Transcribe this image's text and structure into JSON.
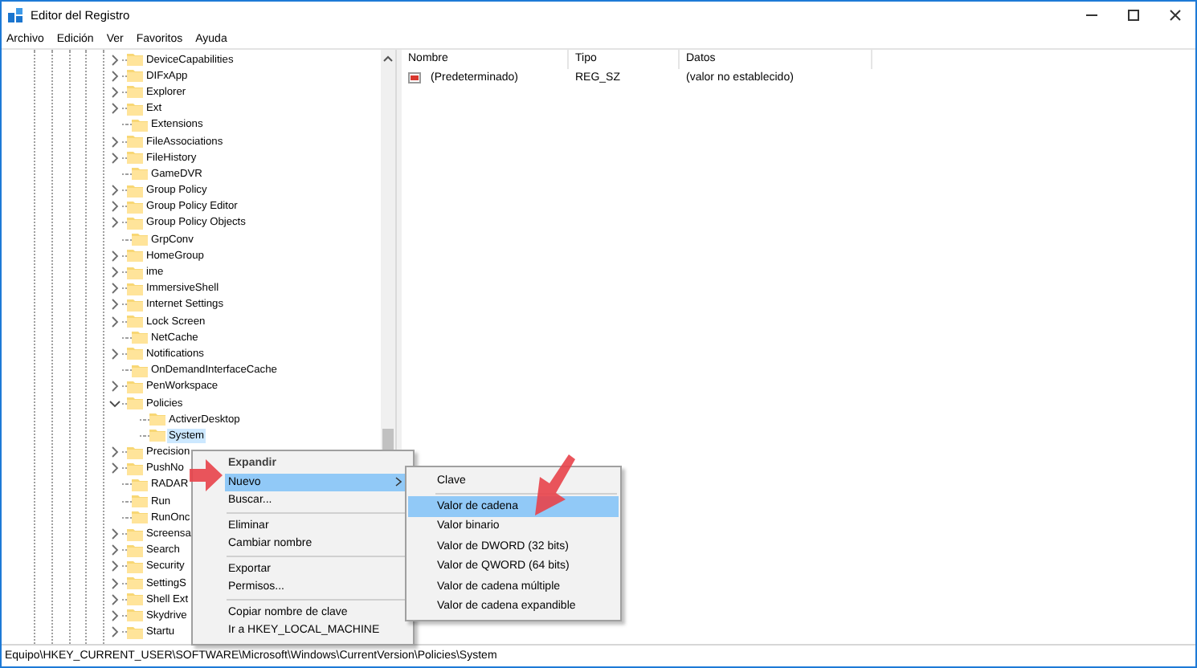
{
  "window": {
    "title": "Editor del Registro"
  },
  "menu_bar": [
    "Archivo",
    "Edición",
    "Ver",
    "Favoritos",
    "Ayuda"
  ],
  "tree": {
    "items": [
      {
        "label": "DeviceCapabilities",
        "kind": "collapsed",
        "selected": false
      },
      {
        "label": "DIFxApp",
        "kind": "collapsed",
        "selected": false
      },
      {
        "label": "Explorer",
        "kind": "collapsed",
        "selected": false
      },
      {
        "label": "Ext",
        "kind": "collapsed",
        "selected": false
      },
      {
        "label": "Extensions",
        "kind": "leaf",
        "selected": false
      },
      {
        "label": "FileAssociations",
        "kind": "collapsed",
        "selected": false
      },
      {
        "label": "FileHistory",
        "kind": "collapsed",
        "selected": false
      },
      {
        "label": "GameDVR",
        "kind": "leaf",
        "selected": false
      },
      {
        "label": "Group Policy",
        "kind": "collapsed",
        "selected": false
      },
      {
        "label": "Group Policy Editor",
        "kind": "collapsed",
        "selected": false
      },
      {
        "label": "Group Policy Objects",
        "kind": "collapsed",
        "selected": false
      },
      {
        "label": "GrpConv",
        "kind": "leaf",
        "selected": false
      },
      {
        "label": "HomeGroup",
        "kind": "collapsed",
        "selected": false
      },
      {
        "label": "ime",
        "kind": "collapsed",
        "selected": false
      },
      {
        "label": "ImmersiveShell",
        "kind": "collapsed",
        "selected": false
      },
      {
        "label": "Internet Settings",
        "kind": "collapsed",
        "selected": false
      },
      {
        "label": "Lock Screen",
        "kind": "collapsed",
        "selected": false
      },
      {
        "label": "NetCache",
        "kind": "leaf",
        "selected": false
      },
      {
        "label": "Notifications",
        "kind": "collapsed",
        "selected": false
      },
      {
        "label": "OnDemandInterfaceCache",
        "kind": "leaf",
        "selected": false
      },
      {
        "label": "PenWorkspace",
        "kind": "collapsed",
        "selected": false
      },
      {
        "label": "Policies",
        "kind": "expanded",
        "selected": false,
        "children": [
          {
            "label": "ActiverDesktop",
            "kind": "leaf",
            "selected": false
          },
          {
            "label": "System",
            "kind": "leaf",
            "selected": true
          }
        ]
      },
      {
        "label": "Precision",
        "kind": "collapsed",
        "selected": false
      },
      {
        "label": "PushNo",
        "kind": "collapsed",
        "selected": false
      },
      {
        "label": "RADAR",
        "kind": "leaf",
        "selected": false
      },
      {
        "label": "Run",
        "kind": "leaf",
        "selected": false
      },
      {
        "label": "RunOnc",
        "kind": "leaf",
        "selected": false
      },
      {
        "label": "Screensa",
        "kind": "collapsed",
        "selected": false
      },
      {
        "label": "Search",
        "kind": "collapsed",
        "selected": false
      },
      {
        "label": "Security",
        "kind": "collapsed",
        "selected": false
      },
      {
        "label": "SettingS",
        "kind": "collapsed",
        "selected": false
      },
      {
        "label": "Shell Ext",
        "kind": "collapsed",
        "selected": false
      },
      {
        "label": "Skydrive",
        "kind": "collapsed",
        "selected": false
      },
      {
        "label": "Startu",
        "kind": "collapsed",
        "selected": false
      }
    ]
  },
  "values_list": {
    "columns": [
      "Nombre",
      "Tipo",
      "Datos"
    ],
    "rows": [
      {
        "name": "(Predeterminado)",
        "type": "REG_SZ",
        "data": "(valor no establecido)"
      }
    ]
  },
  "context_menu": {
    "items": [
      {
        "kind": "default",
        "label": "Expandir",
        "selected": false
      },
      {
        "kind": "submenu",
        "label": "Nuevo",
        "selected": true
      },
      {
        "kind": "item",
        "label": "Buscar...",
        "selected": false
      },
      {
        "kind": "separator"
      },
      {
        "kind": "item",
        "label": "Eliminar",
        "selected": false
      },
      {
        "kind": "item",
        "label": "Cambiar nombre",
        "selected": false
      },
      {
        "kind": "separator"
      },
      {
        "kind": "item",
        "label": "Exportar",
        "selected": false
      },
      {
        "kind": "item",
        "label": "Permisos...",
        "selected": false
      },
      {
        "kind": "separator"
      },
      {
        "kind": "item",
        "label": "Copiar nombre de clave",
        "selected": false
      },
      {
        "kind": "item",
        "label": "Ir a HKEY_LOCAL_MACHINE",
        "selected": false
      }
    ]
  },
  "submenu": {
    "items": [
      {
        "kind": "item",
        "label": "Clave",
        "selected": false
      },
      {
        "kind": "separator"
      },
      {
        "kind": "item",
        "label": "Valor de cadena",
        "selected": true
      },
      {
        "kind": "item",
        "label": "Valor binario",
        "selected": false
      },
      {
        "kind": "item",
        "label": "Valor de DWORD (32 bits)",
        "selected": false
      },
      {
        "kind": "item",
        "label": "Valor de QWORD (64 bits)",
        "selected": false
      },
      {
        "kind": "item",
        "label": "Valor de cadena múltiple",
        "selected": false
      },
      {
        "kind": "item",
        "label": "Valor de cadena expandible",
        "selected": false
      }
    ]
  },
  "status_bar": "Equipo\\HKEY_CURRENT_USER\\SOFTWARE\\Microsoft\\Windows\\CurrentVersion\\Policies\\System"
}
